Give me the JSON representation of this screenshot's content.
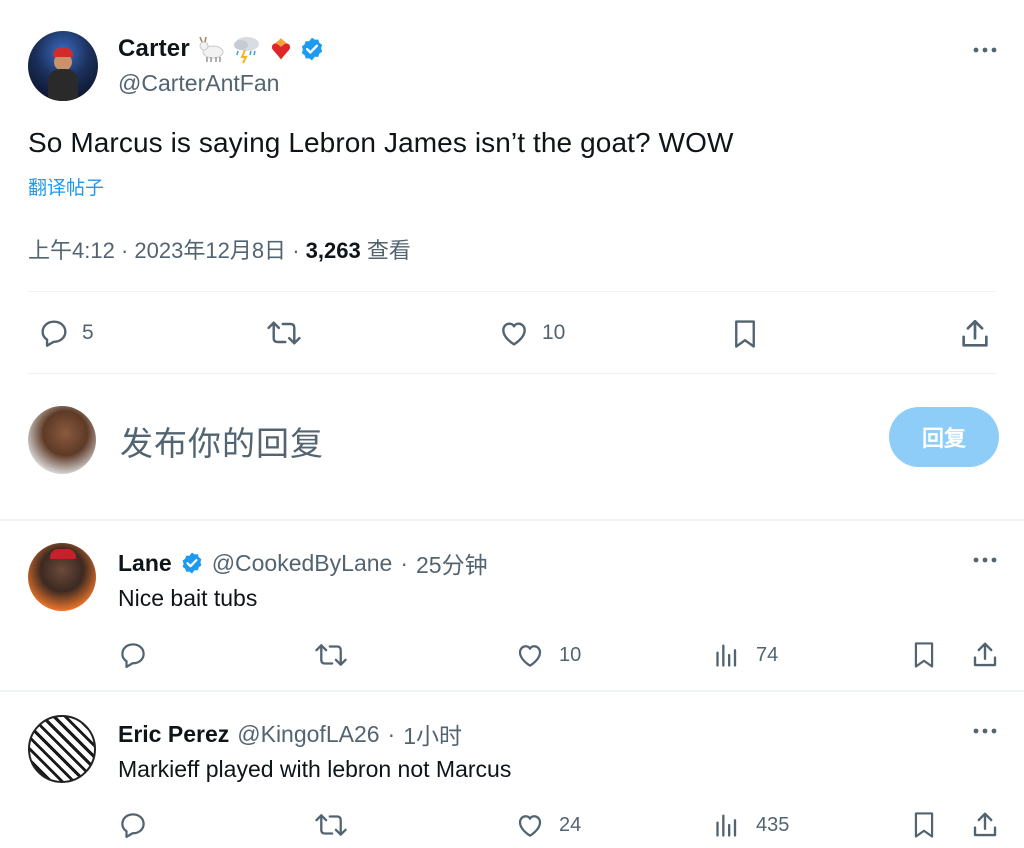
{
  "main_tweet": {
    "display_name": "Carter",
    "handle": "@CarterAntFan",
    "text": "So Marcus is saying Lebron James isn’t the goat? WOW",
    "translate_label": "翻译帖子",
    "time": "上午4:12",
    "date": "2023年12月8日",
    "views_count": "3,263",
    "views_label": "查看",
    "separator": "·",
    "icons": [
      "goat-emoji",
      "storm-cloud-emoji",
      "heart-fire-emoji",
      "verified-badge-icon"
    ],
    "actions": {
      "replies": "5",
      "retweets": "",
      "likes": "10"
    }
  },
  "composer": {
    "placeholder": "发布你的回复",
    "reply_button": "回复"
  },
  "replies": [
    {
      "name": "Lane",
      "verified": true,
      "handle": "@CookedByLane",
      "time": "25分钟",
      "text": "Nice bait tubs",
      "replies": "",
      "retweets": "",
      "likes": "10",
      "views": "74"
    },
    {
      "name": "Eric Perez",
      "verified": false,
      "handle": "@KingofLA26",
      "time": "1小时",
      "text": "Markieff played with lebron not Marcus",
      "replies": "",
      "retweets": "",
      "likes": "24",
      "views": "435"
    }
  ],
  "colors": {
    "text": "#0f1419",
    "muted": "#536471",
    "accent": "#1d9bf0",
    "reply_button": "#8ecdf8",
    "divider": "#eff3f4"
  }
}
